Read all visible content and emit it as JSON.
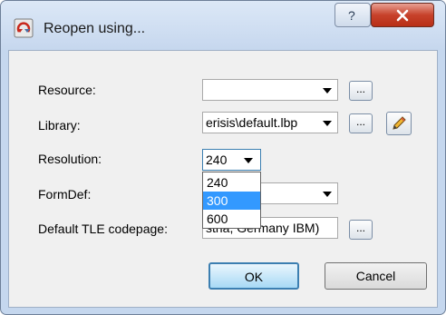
{
  "window": {
    "title": "Reopen using..."
  },
  "title_buttons": {
    "help": "?",
    "close": "X"
  },
  "form": {
    "resource": {
      "label": "Resource:",
      "value": "",
      "browse": "..."
    },
    "library": {
      "label": "Library:",
      "value": "erisis\\default.lbp",
      "browse": "..."
    },
    "resolution": {
      "label": "Resolution:",
      "value": "240",
      "options": [
        "240",
        "300",
        "600"
      ],
      "highlighted": "300"
    },
    "formdef": {
      "label": "FormDef:",
      "value": ""
    },
    "codepage": {
      "label": "Default TLE codepage:",
      "value": "stria, Germany IBM)",
      "browse": "..."
    }
  },
  "buttons": {
    "ok": "OK",
    "cancel": "Cancel"
  },
  "colors": {
    "highlight": "#3399ff",
    "close_red": "#c7422b",
    "titlebar": "#c6d7ee"
  },
  "icons": [
    "reopen-app-icon",
    "help-icon",
    "close-icon",
    "pencil-icon",
    "dropdown-arrow-icon"
  ]
}
